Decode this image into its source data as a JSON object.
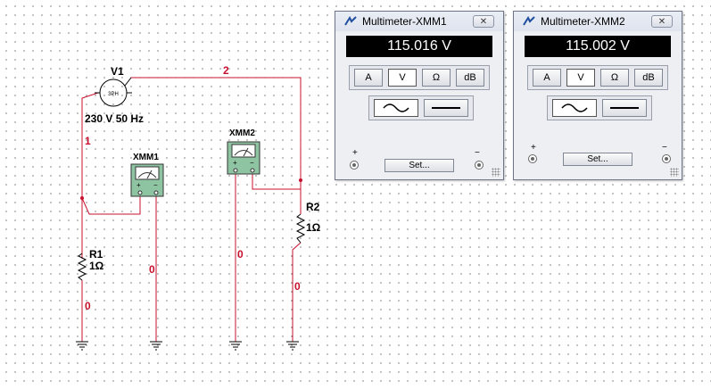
{
  "schematic": {
    "source": {
      "name": "V1",
      "value": "230 V 50 Hz",
      "symbol_text": "3PH"
    },
    "resistors": [
      {
        "name": "R1",
        "value": "1Ω"
      },
      {
        "name": "R2",
        "value": "1Ω"
      }
    ],
    "meters": [
      {
        "name": "XMM1"
      },
      {
        "name": "XMM2"
      }
    ],
    "nets": {
      "n1": "1",
      "n2": "2",
      "g1": "0",
      "g2": "0",
      "g3": "0",
      "g4": "0"
    }
  },
  "multimeters": [
    {
      "title": "Multimeter-XMM1",
      "reading": "115.016 V",
      "buttons": [
        "A",
        "V",
        "Ω",
        "dB"
      ],
      "active": "V",
      "set_label": "Set...",
      "plus": "+",
      "minus": "−"
    },
    {
      "title": "Multimeter-XMM2",
      "reading": "115.002 V",
      "buttons": [
        "A",
        "V",
        "Ω",
        "dB"
      ],
      "active": "V",
      "set_label": "Set...",
      "plus": "+",
      "minus": "−"
    }
  ],
  "colors": {
    "wire": "#c8102e",
    "display_bg": "#000000",
    "display_fg": "#ffffff"
  }
}
